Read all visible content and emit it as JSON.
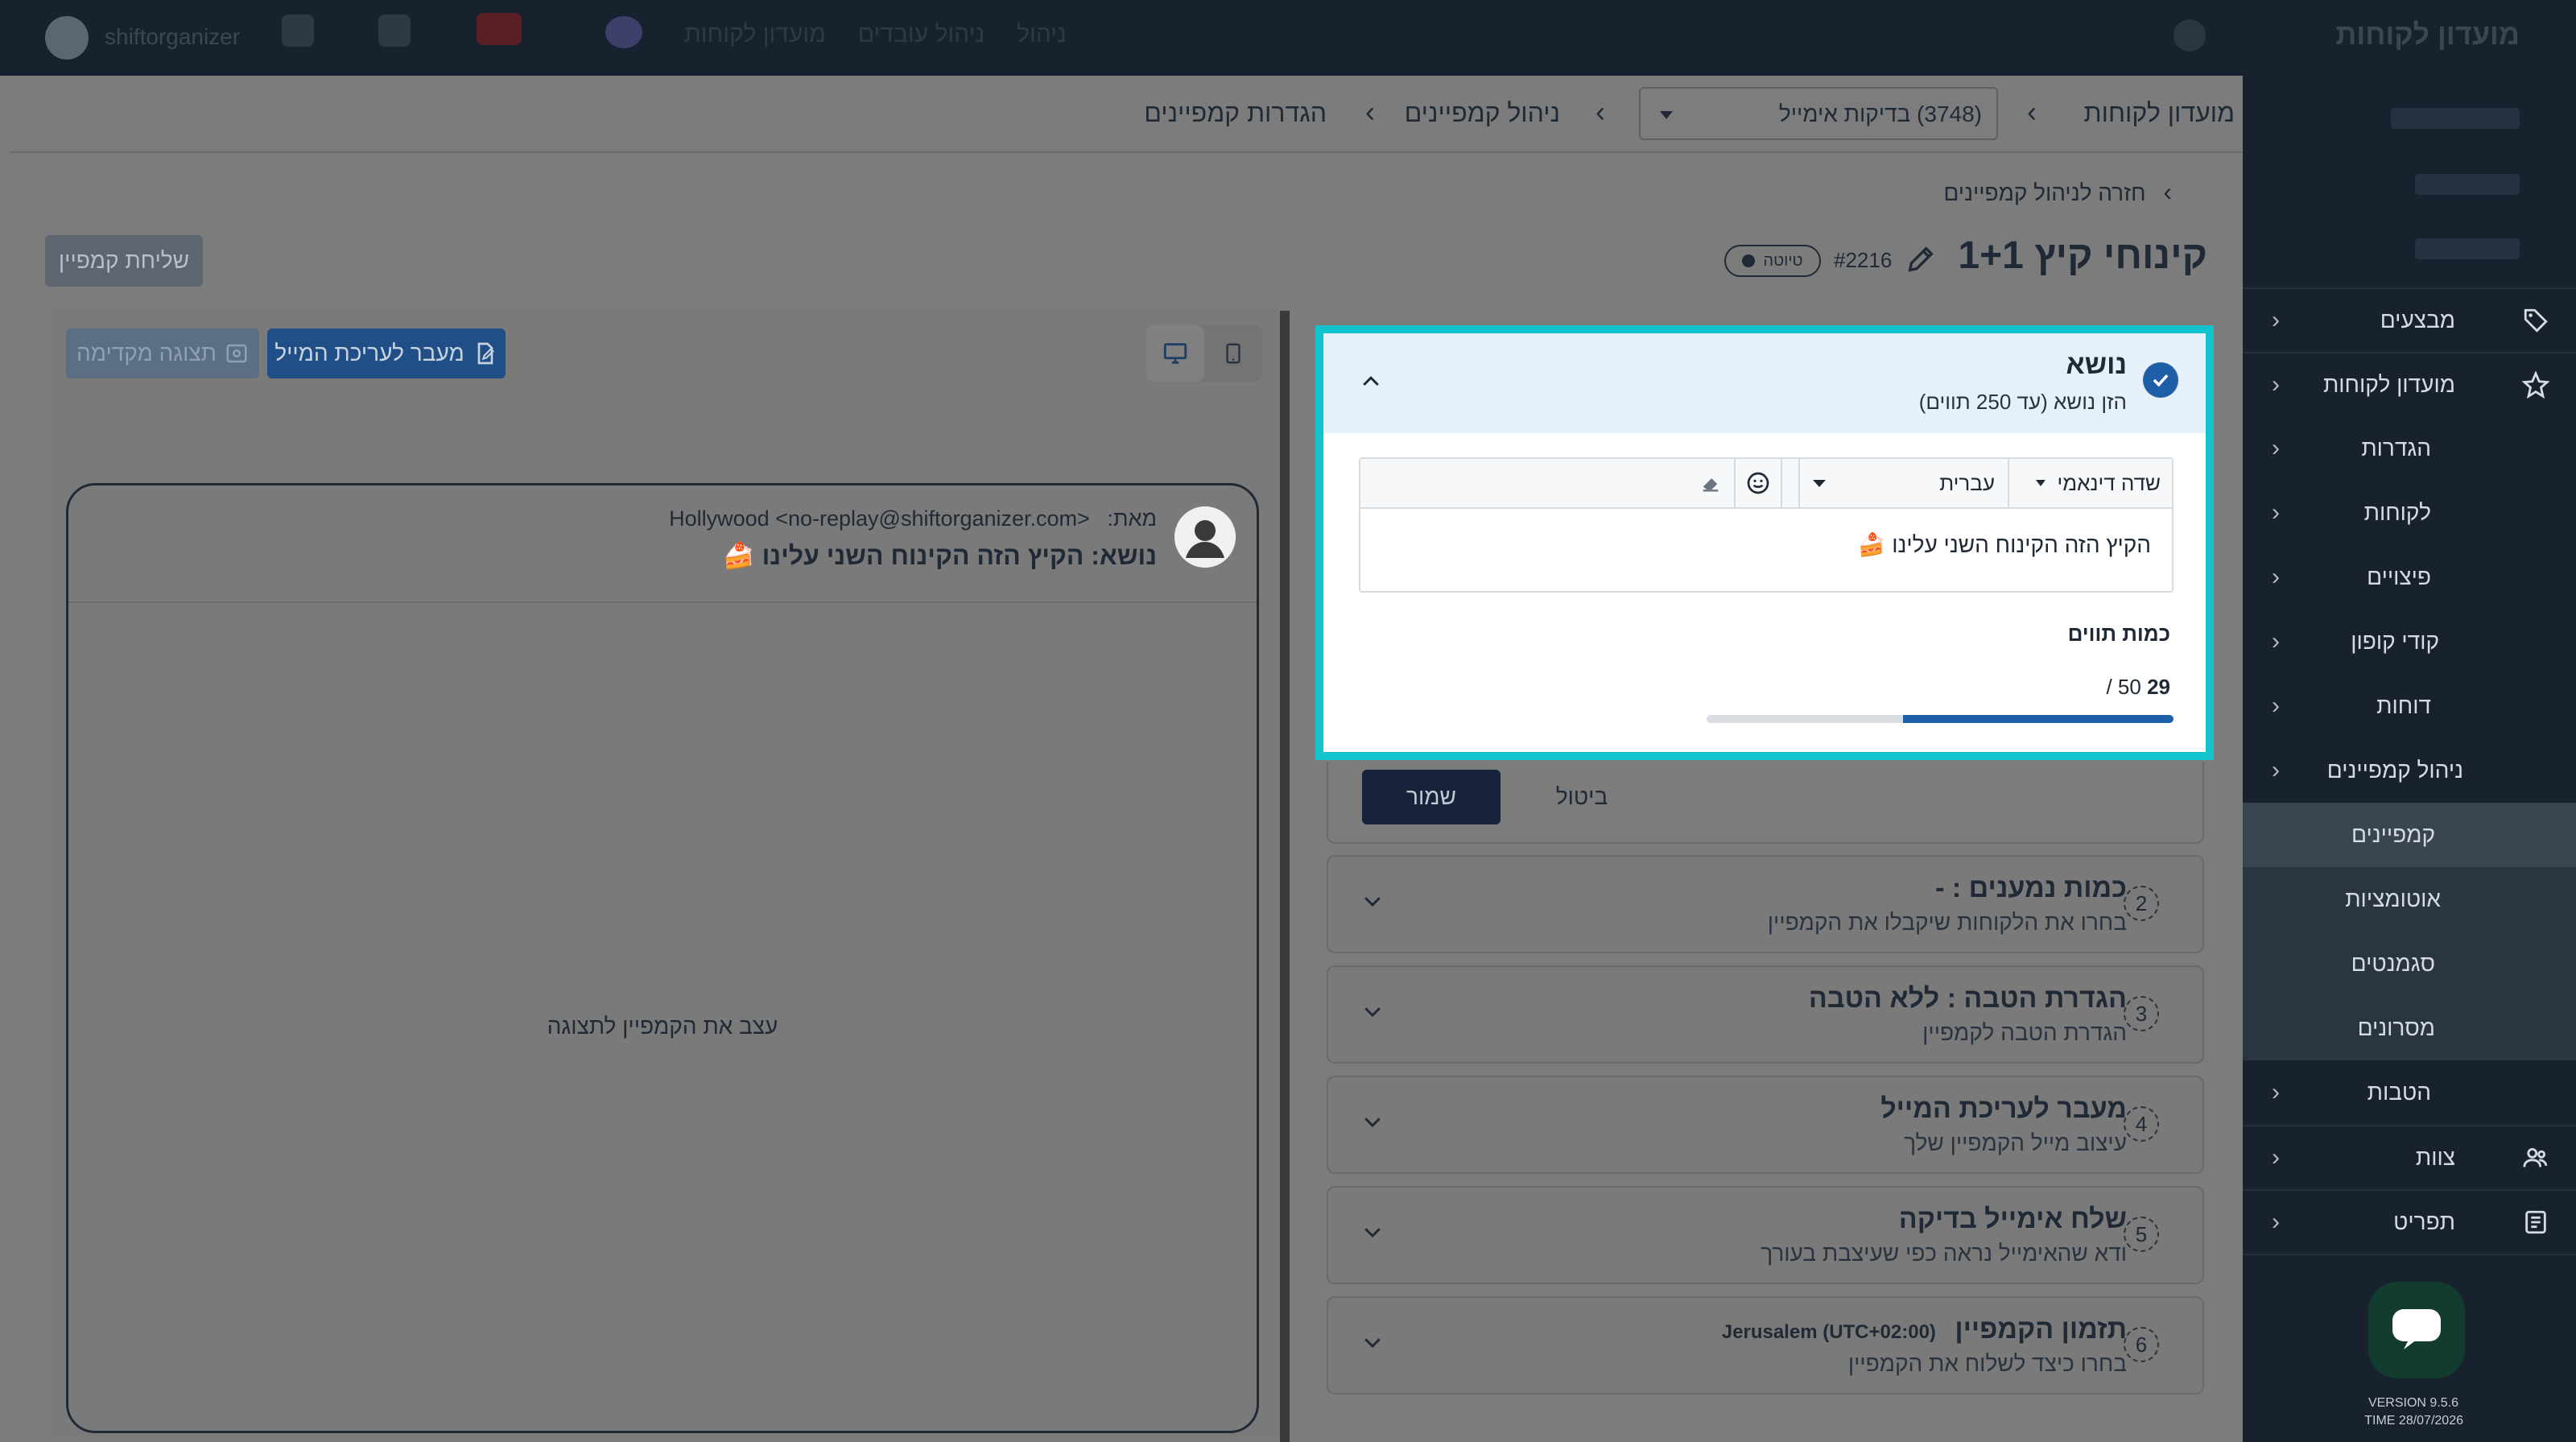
{
  "topbar": {
    "brand": "מועדון לקוחות",
    "items": [
      "מועדון לקוחות",
      "ניהול עובדים",
      "ניהול"
    ],
    "left_label": "shiftorganizer"
  },
  "sidebar": {
    "items": [
      {
        "label": "מבצעים",
        "icon": "tag-icon"
      },
      {
        "label": "מועדון לקוחות",
        "icon": "star-icon"
      },
      {
        "label": "הגדרות"
      },
      {
        "label": "לקוחות"
      },
      {
        "label": "פיצויים"
      },
      {
        "label": "קודי קופון"
      },
      {
        "label": "דוחות"
      },
      {
        "label": "ניהול קמפיינים"
      }
    ],
    "sub_items": [
      "קמפיינים",
      "אוטומציות",
      "סגמנטים",
      "מסרונים"
    ],
    "bottom_items": [
      {
        "label": "הטבות"
      },
      {
        "label": "צוות",
        "icon": "team-icon"
      },
      {
        "label": "תפריט",
        "icon": "menu-book-icon"
      }
    ],
    "version": "VERSION 9.5.6",
    "time": "TIME 28/07/2026"
  },
  "breadcrumb": {
    "root": "מועדון לקוחות",
    "dropdown_value": "(3748) בדיקות אימייל",
    "level2": "ניהול קמפיינים",
    "level3": "הגדרות קמפיינים"
  },
  "back_link": "חזרה לניהול קמפיינים",
  "campaign": {
    "title": "קינוחי קיץ 1+1",
    "id": "#2216",
    "status": "טיוטה",
    "send_button": "שליחת קמפיין"
  },
  "preview": {
    "edit_button": "מעבר לעריכת המייל",
    "preview_button": "תצוגה מקדימה",
    "from_label": "מאת:",
    "from_value": "Hollywood <no-replay@shiftorganizer.com>",
    "subject_line": "נושא: הקיץ הזה הקינוח השני עלינו 🍰",
    "placeholder": "עצב את הקמפיין לתצוגה"
  },
  "subject_panel": {
    "title": "נושא",
    "subtitle": "הזן נושא (עד 250 תווים)",
    "dynamic_field": "שדה דינאמי",
    "language": "עברית",
    "value": "הקיץ הזה הקינוח השני עלינו 🍰",
    "char_count_label": "כמות תווים",
    "char_count_current": "29",
    "char_count_max": "/ 50",
    "progress_fraction": 0.58
  },
  "actions": {
    "save": "שמור",
    "cancel": "ביטול"
  },
  "steps": [
    {
      "num": "2",
      "title": "כמות נמענים : -",
      "subtitle": "בחרו את הלקוחות שיקבלו את הקמפיין"
    },
    {
      "num": "3",
      "title": "הגדרת הטבה : ללא הטבה",
      "subtitle": "הגדרת הטבה לקמפיין"
    },
    {
      "num": "4",
      "title": "מעבר לעריכת המייל",
      "subtitle": "עיצוב מייל הקמפיין שלך"
    },
    {
      "num": "5",
      "title": "שלח אימייל בדיקה",
      "subtitle": "ודא שהאימייל נראה כפי שעיצבת בעורך"
    },
    {
      "num": "6",
      "title": "תזמון הקמפיין",
      "subtitle": "בחרו כיצד לשלוח את הקמפיין",
      "extra": "Jerusalem (UTC+02:00)"
    }
  ],
  "colors": {
    "highlight": "#12c2cc",
    "primary": "#1f5fa8",
    "progress": "#1f5fa8"
  }
}
